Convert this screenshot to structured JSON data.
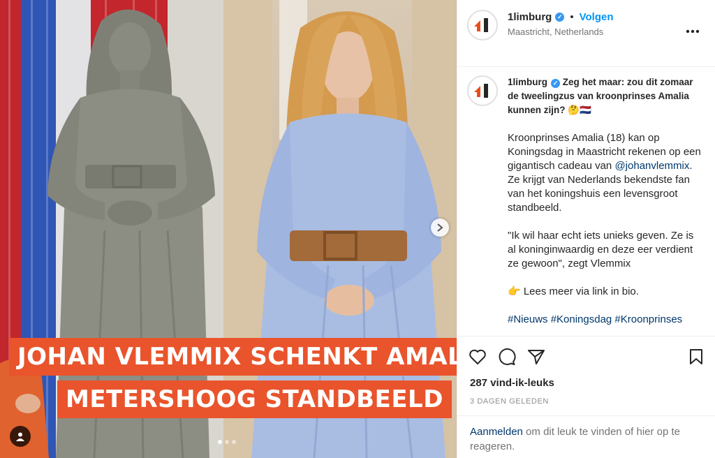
{
  "media": {
    "banner_line1": "JOHAN VLEMMIX SCHENKT AMALIA",
    "banner_line2": "METERSHOOG STANDBEELD",
    "carousel_next_icon": "chevron-right-icon",
    "carousel_dots": 3,
    "carousel_active_dot": 0,
    "colors": {
      "banner": "#e9542c"
    }
  },
  "header": {
    "username": "1limburg",
    "separator": "•",
    "follow_label": "Volgen",
    "location": "Maastricht, Netherlands",
    "more_icon": "more-horizontal-icon"
  },
  "caption": {
    "username": "1limburg",
    "headline": "Zeg het maar: zou dit zomaar de tweelingzus van kroonprinses Amalia kunnen zijn? 🤔🇳🇱",
    "p1_before": "Kroonprinses Amalia (18) kan op Koningsdag in Maastricht rekenen op een gigantisch cadeau van ",
    "p1_mention": "@johanvlemmix",
    "p1_after": ". Ze krijgt van Nederlands bekendste fan van het koningshuis een levensgroot standbeeld.",
    "p2": "\"Ik wil haar echt iets unieks geven. Ze is al koninginwaardig en deze eer verdient ze gewoon\", zegt Vlemmix",
    "p3": "👉 Lees meer via link in bio.",
    "hashtags": "#Nieuws #Koningsdag #Kroonprinses"
  },
  "actions": {
    "like_icon": "heart-icon",
    "comment_icon": "comment-icon",
    "share_icon": "send-icon",
    "save_icon": "bookmark-icon"
  },
  "likes": "287 vind-ik-leuks",
  "timestamp": "3 DAGEN GELEDEN",
  "login": {
    "link": "Aanmelden",
    "rest": " om dit leuk te vinden of hier op te reageren."
  },
  "colors": {
    "accent": "#0095f6",
    "link": "#00376b",
    "brand": "#e94e1b"
  }
}
